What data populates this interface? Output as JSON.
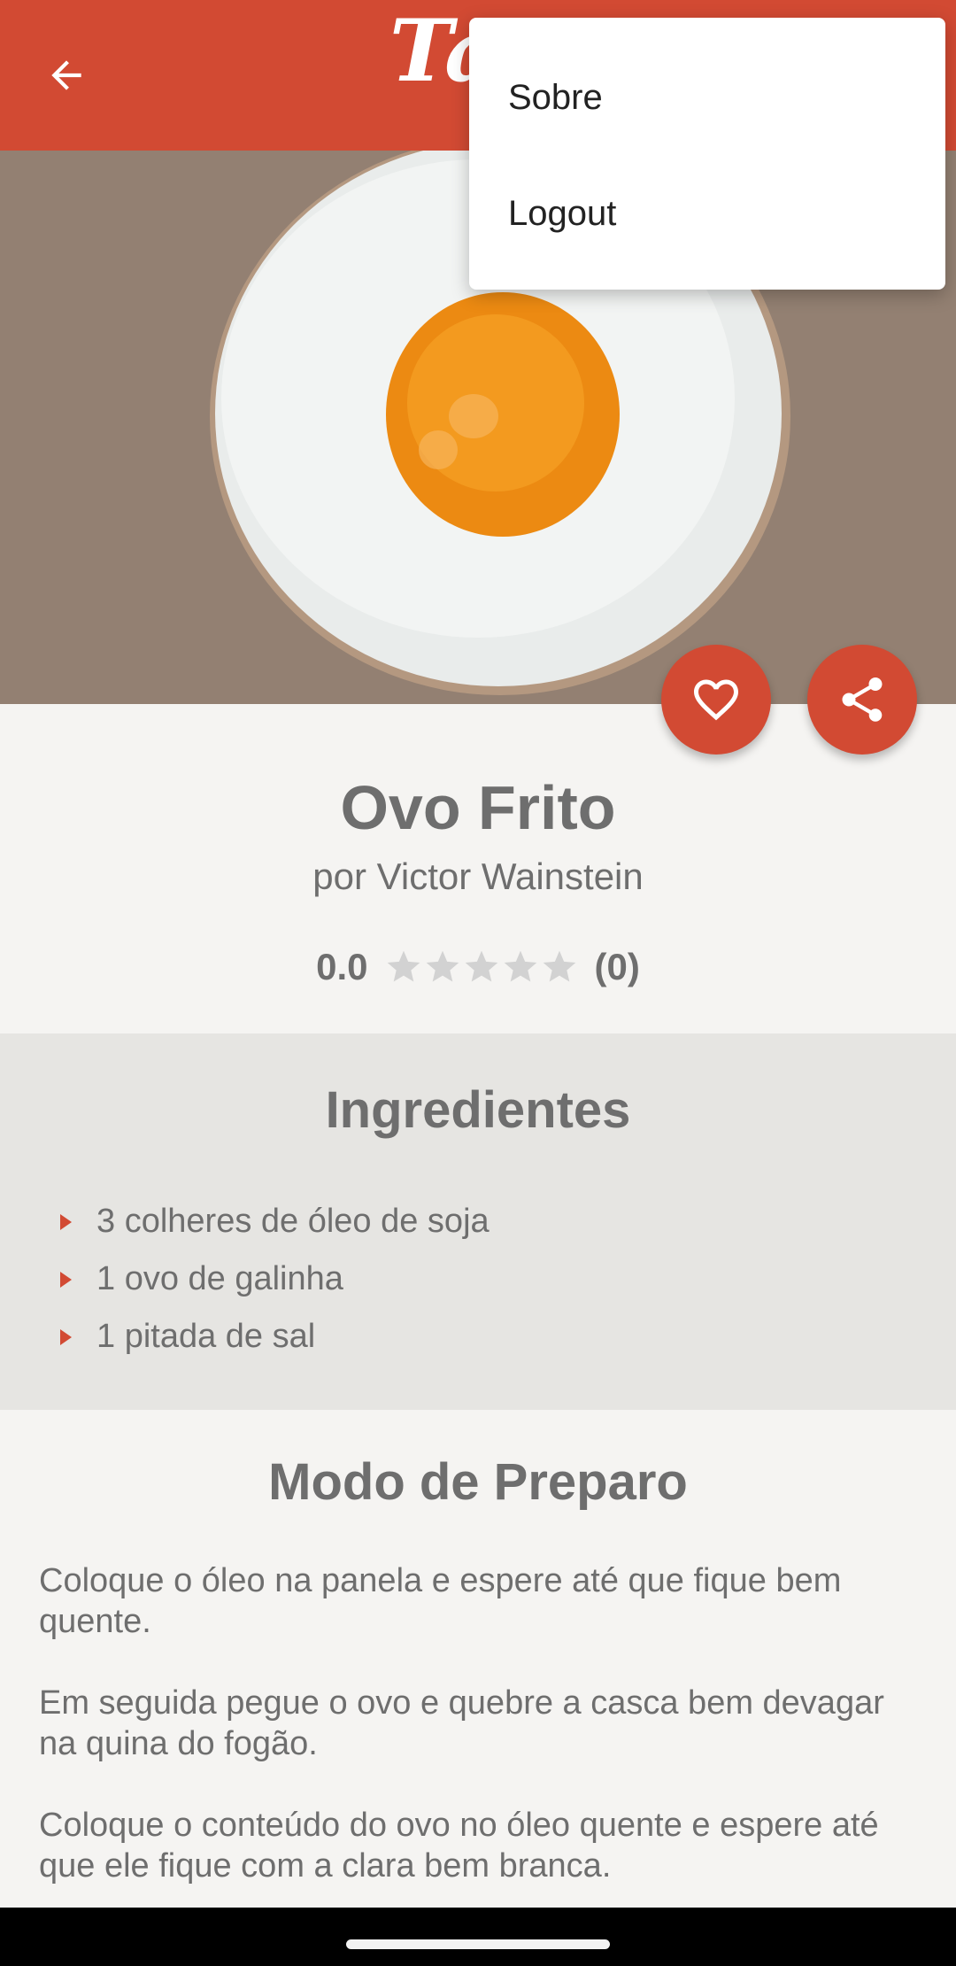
{
  "app": {
    "logo_text": "Ta",
    "brand_color": "#d24a33"
  },
  "menu": {
    "items": [
      {
        "label": "Sobre"
      },
      {
        "label": "Logout"
      }
    ]
  },
  "hero": {
    "image": "fried-egg-photo"
  },
  "recipe": {
    "title": "Ovo Frito",
    "author": "por Victor Wainstein",
    "rating_value": "0.0",
    "rating_stars": 0,
    "rating_max": 5,
    "rating_count": "(0)"
  },
  "ingredients": {
    "title": "Ingredientes",
    "items": [
      "3 colheres de óleo de soja",
      "1 ovo de galinha",
      "1 pitada de sal"
    ]
  },
  "preparation": {
    "title": "Modo de Preparo",
    "steps": [
      "Coloque o óleo na panela e espere até que fique bem quente.",
      "Em seguida pegue o ovo e quebre a casca bem devagar na quina do fogão.",
      "Coloque o conteúdo do ovo no óleo quente e espere até que ele fique com a clara bem branca."
    ]
  },
  "icons": {
    "back": "arrow-left-icon",
    "favorite": "heart-outline-icon",
    "share": "share-icon",
    "star": "star-icon"
  }
}
